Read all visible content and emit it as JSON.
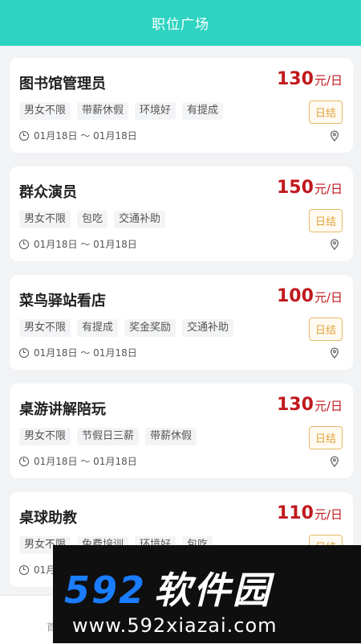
{
  "header": {
    "title": "职位广场"
  },
  "jobs": [
    {
      "title": "图书馆管理员",
      "price": "130",
      "unit": "元/日",
      "tags": [
        "男女不限",
        "带薪休假",
        "环境好",
        "有提成"
      ],
      "settle": "日结",
      "date": "01月18日 ～ 01月18日"
    },
    {
      "title": "群众演员",
      "price": "150",
      "unit": "元/日",
      "tags": [
        "男女不限",
        "包吃",
        "交通补助"
      ],
      "settle": "日结",
      "date": "01月18日 ～ 01月18日"
    },
    {
      "title": "菜鸟驿站看店",
      "price": "100",
      "unit": "元/日",
      "tags": [
        "男女不限",
        "有提成",
        "奖金奖励",
        "交通补助"
      ],
      "settle": "日结",
      "date": "01月18日 ～ 01月18日"
    },
    {
      "title": "桌游讲解陪玩",
      "price": "130",
      "unit": "元/日",
      "tags": [
        "男女不限",
        "节假日三薪",
        "带薪休假"
      ],
      "settle": "日结",
      "date": "01月18日 ～ 01月18日"
    },
    {
      "title": "桌球助教",
      "price": "110",
      "unit": "元/日",
      "tags": [
        "男女不限",
        "免费培训",
        "环境好",
        "包吃"
      ],
      "settle": "日结",
      "date": "01月18日 ～ 01月18日"
    }
  ],
  "watermark": {
    "logo_num": "592",
    "logo_text": "软件园",
    "url": "www.592xiazai.com"
  },
  "bottom": {
    "char": "首"
  },
  "colors": {
    "header": "#2ed3c1",
    "price": "#c0191e",
    "settle_border": "#e6b869"
  }
}
